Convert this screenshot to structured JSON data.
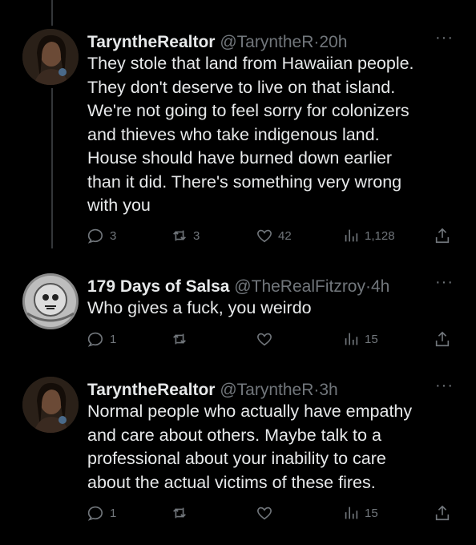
{
  "tweets": [
    {
      "author": "TaryntheRealtor",
      "handle": "@TaryntheR",
      "time": "20h",
      "more": "···",
      "lines": [
        "They stole that land from Hawaiian people.",
        "They don't deserve to live on that island.",
        "We're not going to feel sorry for colonizers",
        "and thieves who take indigenous land.",
        "House should have burned down earlier",
        "than it did. There's something very wrong",
        "with you"
      ],
      "replies": "3",
      "retweets": "3",
      "likes": "42",
      "views": "1,128"
    },
    {
      "author": "179 Days of Salsa",
      "handle": "@TheRealFitzroy",
      "time": "4h",
      "more": "···",
      "lines": [
        "Who gives a fuck, you weirdo"
      ],
      "replies": "1",
      "retweets": "",
      "likes": "",
      "views": "15"
    },
    {
      "author": "TaryntheRealtor",
      "handle": "@TaryntheR",
      "time": "3h",
      "more": "···",
      "lines": [
        "Normal people who actually have empathy",
        "and care about others. Maybe talk to a",
        "professional about your inability to care",
        "about the actual victims of these fires."
      ],
      "replies": "1",
      "retweets": "",
      "likes": "",
      "views": "15"
    }
  ],
  "separator": "·",
  "colors": {
    "background": "#000000",
    "text": "#e7e9ea",
    "muted": "#71767b"
  }
}
